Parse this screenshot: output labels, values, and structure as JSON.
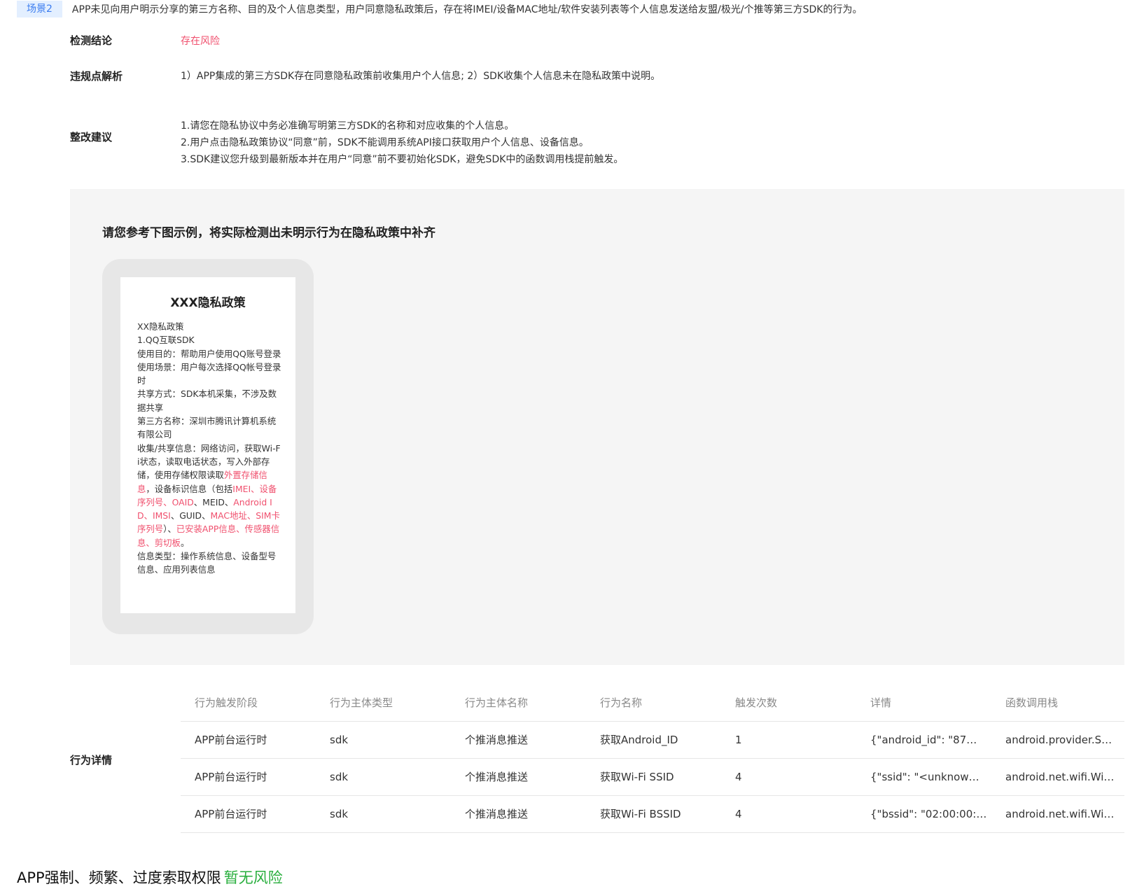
{
  "scene": {
    "tag": "场景2",
    "description": "APP未见向用户明示分享的第三方名称、目的及个人信息类型，用户同意隐私政策后，存在将IMEI/设备MAC地址/软件安装列表等个人信息发送给友盟/极光/个推等第三方SDK的行为。"
  },
  "conclusion": {
    "label": "检测结论",
    "value": "存在风险"
  },
  "analysis": {
    "label": "违规点解析",
    "value": "1）APP集成的第三方SDK存在同意隐私政策前收集用户个人信息; 2）SDK收集个人信息未在隐私政策中说明。"
  },
  "suggestion": {
    "label": "整改建议",
    "lines": [
      "1.请您在隐私协议中务必准确写明第三方SDK的名称和对应收集的个人信息。",
      "2.用户点击隐私政策协议“同意”前，SDK不能调用系统API接口获取用户个人信息、设备信息。",
      "3.SDK建议您升级到最新版本并在用户“同意”前不要初始化SDK，避免SDK中的函数调用栈提前触发。"
    ]
  },
  "example": {
    "title": "请您参考下图示例，将实际检测出未明示行为在隐私政策中补齐",
    "policy": {
      "title": "XXX隐私政策",
      "l1": "XX隐私政策",
      "l2": "1.QQ互联SDK",
      "l3": "使用目的：帮助用户使用QQ账号登录",
      "l4": "使用场景：用户每次选择QQ帐号登录时",
      "l5": "共享方式：SDK本机采集，不涉及数据共享",
      "l6": "第三方名称：深圳市腾讯计算机系统有限公司",
      "c1": "收集/共享信息：网络访问，获取Wi-Fi状态，读取电话状态，写入外部存储，使用存储权限读取",
      "h1": "外置存储信息",
      "c2": "，设备标识信息（包括",
      "h2": "IMEI",
      "s1": "、",
      "h3": "设备序列号",
      "s2": "、",
      "h4": "OAID",
      "c3": "、MEID、",
      "h5": "Android ID",
      "s3": "、",
      "h6": "IMSI",
      "c4": "、GUID、",
      "h7": "MAC地址",
      "s4": "、",
      "h8": "SIM卡序列号",
      "c5": "）、",
      "h9": "已安装APP信息",
      "s5": "、",
      "h10": "传感器信息",
      "s6": "、",
      "h11": "剪切板",
      "c6": "。",
      "l8": "信息类型：操作系统信息、设备型号信息、应用列表信息"
    }
  },
  "details": {
    "label": "行为详情",
    "columns": [
      "行为触发阶段",
      "行为主体类型",
      "行为主体名称",
      "行为名称",
      "触发次数",
      "详情",
      "函数调用栈"
    ],
    "rows": [
      [
        "APP前台运行时",
        "sdk",
        "个推消息推送",
        "获取Android_ID",
        "1",
        "{\"android_id\": \"87…",
        "android.provider.S…"
      ],
      [
        "APP前台运行时",
        "sdk",
        "个推消息推送",
        "获取Wi-Fi SSID",
        "4",
        "{\"ssid\": \"<unknow…",
        "android.net.wifi.Wi…"
      ],
      [
        "APP前台运行时",
        "sdk",
        "个推消息推送",
        "获取Wi-Fi BSSID",
        "4",
        "{\"bssid\": \"02:00:00:…",
        "android.net.wifi.Wi…"
      ]
    ]
  },
  "next_section": {
    "title": "APP强制、频繁、过度索取权限",
    "status": "暂无风险"
  },
  "colors": {
    "risk": "#f0506e",
    "safe": "#27ae3c",
    "tag_bg": "#e3efff",
    "tag_text": "#3b7cf0",
    "panel_bg": "#f5f5f5"
  }
}
